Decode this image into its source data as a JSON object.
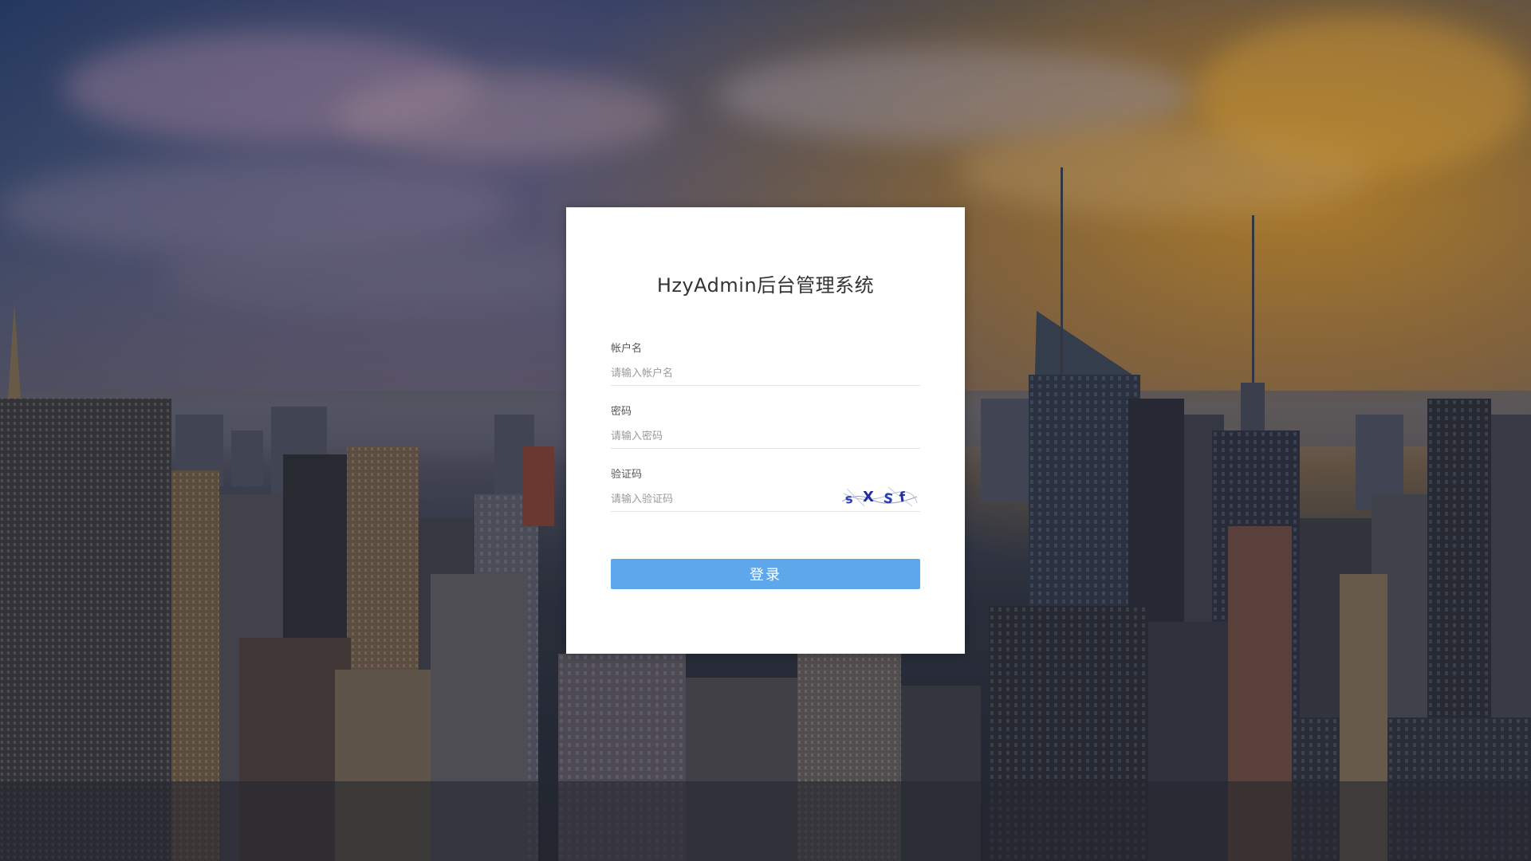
{
  "app": {
    "title": "HzyAdmin后台管理系统"
  },
  "form": {
    "username": {
      "label": "帐户名",
      "placeholder": "请输入帐户名",
      "value": ""
    },
    "password": {
      "label": "密码",
      "placeholder": "请输入密码",
      "value": ""
    },
    "captcha": {
      "label": "验证码",
      "placeholder": "请输入验证码",
      "value": "",
      "image_text": "sXSf"
    },
    "submit_label": "登录"
  },
  "colors": {
    "primary_button": "#5ea7ea",
    "card_bg": "#ffffff",
    "title_text": "#333333"
  }
}
